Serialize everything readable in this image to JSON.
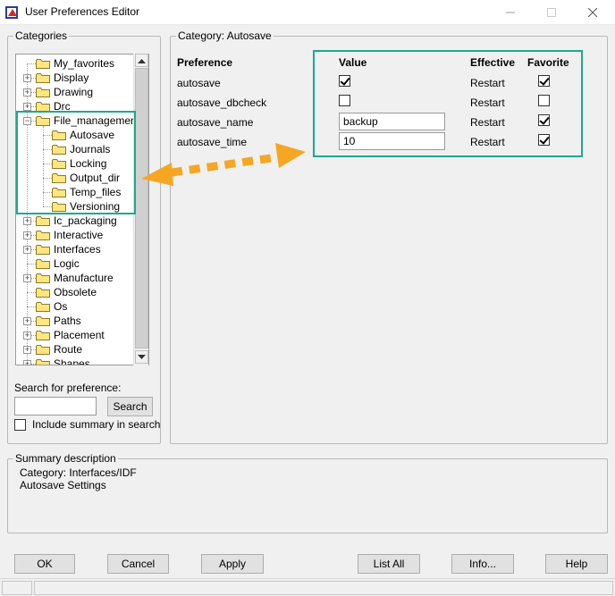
{
  "window": {
    "title": "User Preferences Editor",
    "minimize_symbol": "—",
    "maximize_symbol": "☐",
    "close_symbol": "✕"
  },
  "categories": {
    "title": "Categories",
    "items": [
      {
        "label": "My_favorites",
        "level": 0,
        "expander": ""
      },
      {
        "label": "Display",
        "level": 0,
        "expander": "+"
      },
      {
        "label": "Drawing",
        "level": 0,
        "expander": "+"
      },
      {
        "label": "Drc",
        "level": 0,
        "expander": "+"
      },
      {
        "label": "File_management",
        "level": 0,
        "expander": "-"
      },
      {
        "label": "Autosave",
        "level": 1,
        "expander": ""
      },
      {
        "label": "Journals",
        "level": 1,
        "expander": ""
      },
      {
        "label": "Locking",
        "level": 1,
        "expander": ""
      },
      {
        "label": "Output_dir",
        "level": 1,
        "expander": ""
      },
      {
        "label": "Temp_files",
        "level": 1,
        "expander": ""
      },
      {
        "label": "Versioning",
        "level": 1,
        "expander": ""
      },
      {
        "label": "Ic_packaging",
        "level": 0,
        "expander": "+"
      },
      {
        "label": "Interactive",
        "level": 0,
        "expander": "+"
      },
      {
        "label": "Interfaces",
        "level": 0,
        "expander": "+"
      },
      {
        "label": "Logic",
        "level": 0,
        "expander": ""
      },
      {
        "label": "Manufacture",
        "level": 0,
        "expander": "+"
      },
      {
        "label": "Obsolete",
        "level": 0,
        "expander": ""
      },
      {
        "label": "Os",
        "level": 0,
        "expander": ""
      },
      {
        "label": "Paths",
        "level": 0,
        "expander": "+"
      },
      {
        "label": "Placement",
        "level": 0,
        "expander": "+"
      },
      {
        "label": "Route",
        "level": 0,
        "expander": "+"
      },
      {
        "label": "Shapes",
        "level": 0,
        "expander": "+"
      }
    ]
  },
  "search": {
    "label": "Search for preference:",
    "value": "",
    "button": "Search",
    "include_summary": "Include summary in search",
    "include_summary_checked": false
  },
  "category_panel": {
    "title": "Category:  Autosave",
    "headers": {
      "preference": "Preference",
      "value": "Value",
      "effective": "Effective",
      "favorite": "Favorite"
    },
    "rows": [
      {
        "name": "autosave",
        "value_type": "checkbox",
        "value_checked": true,
        "value_text": "",
        "effective": "Restart",
        "favorite": true
      },
      {
        "name": "autosave_dbcheck",
        "value_type": "checkbox",
        "value_checked": false,
        "value_text": "",
        "effective": "Restart",
        "favorite": false
      },
      {
        "name": "autosave_name",
        "value_type": "text",
        "value_checked": false,
        "value_text": "backup",
        "effective": "Restart",
        "favorite": true
      },
      {
        "name": "autosave_time",
        "value_type": "text",
        "value_checked": false,
        "value_text": "10",
        "effective": "Restart",
        "favorite": true
      }
    ]
  },
  "summary": {
    "title": "Summary description",
    "line1": "Category: Interfaces/IDF",
    "line2": "Autosave Settings"
  },
  "buttons": {
    "ok": "OK",
    "cancel": "Cancel",
    "apply": "Apply",
    "list_all": "List All",
    "info": "Info...",
    "help": "Help"
  },
  "colors": {
    "highlight": "#1ea88f",
    "arrow": "#f5a623",
    "folder": "#ffe680"
  }
}
